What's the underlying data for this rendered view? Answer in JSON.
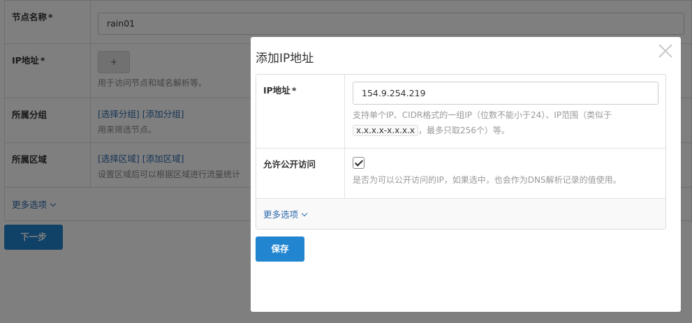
{
  "background_form": {
    "rows": [
      {
        "label": "节点名称",
        "required": "*",
        "input_value": "rain01"
      },
      {
        "label": "IP地址",
        "required": "*",
        "button": "+",
        "hint": "用于访问节点和域名解析等。"
      },
      {
        "label": "所属分组",
        "links": [
          "[选择分组]",
          "[添加分组]"
        ],
        "hint": "用来筛选节点。"
      },
      {
        "label": "所属区域",
        "links": [
          "[选择区域]",
          "[添加区域]"
        ],
        "hint": "设置区域后可以根据区域进行流量统计"
      }
    ],
    "more_options": "更多选项",
    "next_button": "下一步"
  },
  "modal": {
    "title": "添加IP地址",
    "ip_row": {
      "label": "IP地址",
      "required": "*",
      "value": "154.9.254.219",
      "hint_before": "支持单个IP、CIDR格式的一组IP（位数不能小于24）、IP范围（类似于",
      "hint_code": "x.x.x.x-x.x.x.x",
      "hint_after": "，最多只取256个）等。"
    },
    "public_row": {
      "label": "允许公开访问",
      "checked": true,
      "hint": "是否为可以公开访问的IP，如果选中，也会作为DNS解析记录的值使用。"
    },
    "more_options": "更多选项",
    "save_button": "保存"
  },
  "colors": {
    "primary": "#2185d0",
    "link": "#2d6aad",
    "overlay": "rgba(0,0,0,0.5)"
  }
}
